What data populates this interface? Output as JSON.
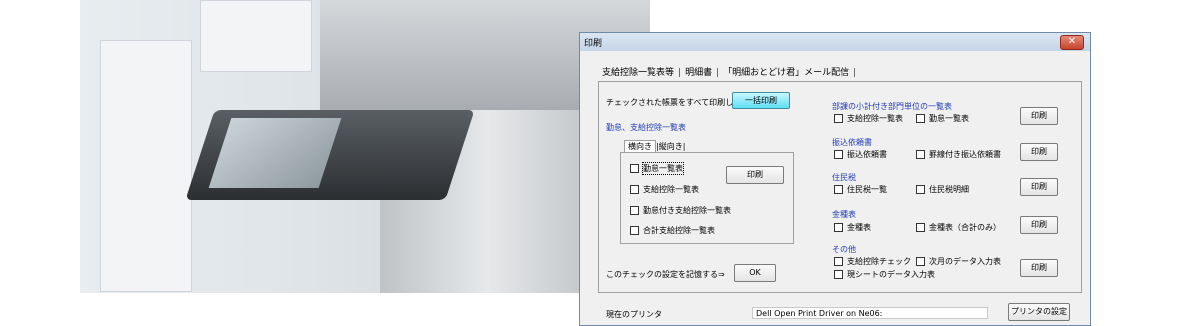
{
  "dialog": {
    "title": "印刷",
    "close_glyph": "✕",
    "tabs": [
      "支給控除一覧表等",
      "明細書",
      "「明細おとどけ君」メール配信"
    ],
    "left": {
      "print_checked_text": "チェックされた帳票をすべて印刷します。",
      "bulk_print_button": "一括印刷",
      "section_title": "勤怠、支給控除一覧表",
      "subtabs": [
        "横向き",
        "縦向き"
      ],
      "checkboxes": [
        "勤怠一覧表",
        "支給控除一覧表",
        "勤怠付き支給控除一覧表",
        "合計支給控除一覧表"
      ],
      "print_button": "印刷",
      "remember_text": "このチェックの設定を記憶する⇒",
      "ok_button": "OK"
    },
    "right": {
      "groups": [
        {
          "title": "部課の小計付き部門単位の一覧表",
          "items": [
            "支給控除一覧表",
            "勤怠一覧表"
          ],
          "button": "印刷"
        },
        {
          "title": "振込依頼書",
          "items": [
            "振込依頼書",
            "罫線付き振込依頼書"
          ],
          "button": "印刷"
        },
        {
          "title": "住民税",
          "items": [
            "住民税一覧",
            "住民税明細"
          ],
          "button": "印刷"
        },
        {
          "title": "金種表",
          "items": [
            "金種表",
            "金種表（合計のみ）"
          ],
          "button": "印刷"
        },
        {
          "title": "その他",
          "items": [
            "支給控除チェック",
            "次月のデータ入力表",
            "現シートのデータ入力表"
          ],
          "button": "印刷"
        }
      ]
    },
    "footer": {
      "printer_label": "現在のプリンタ",
      "printer_value": "Dell Open Print Driver on Ne06:",
      "printer_settings_button": "プリンタの設定"
    }
  },
  "colors": {
    "section_title": "#1f3bb5",
    "bulk_button": "#5fe0f5",
    "close_button": "#c7452c"
  }
}
